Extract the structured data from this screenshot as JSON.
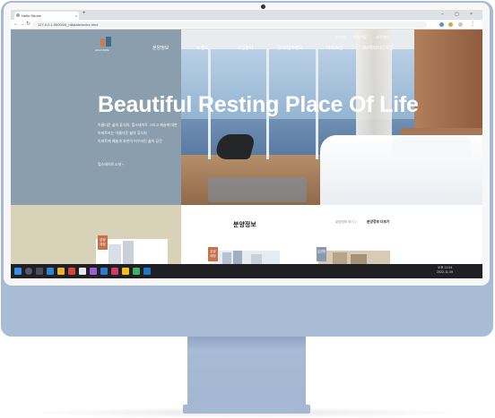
{
  "browser": {
    "tab_title": "Hello Strove",
    "url": "127.0.0.1:5500/09_hillstate/index.html"
  },
  "site": {
    "top_links": [
      "로그인",
      "회원가입",
      "고객센터"
    ],
    "nav": [
      "분양정보",
      "브랜드",
      "사업분야",
      "공사/입주정보",
      "아파트인",
      "BI/캐릭터디자인"
    ],
    "hero": {
      "title": "Beautiful Resting Place Of Life",
      "lines": [
        "아름다운 삶의 휴식처, 힐스테이트 그리고 캐슬에 대한",
        "아파트라는 아름다운 삶의 휴식처",
        "아파트에 예술과 자연이 어우러진 삶의 공간"
      ],
      "more": "힐스테이트소개 +"
    },
    "section": {
      "title": "분양정보",
      "crumb_prev": "분양정보 보기 >",
      "crumb_current": "분양정보 더보기"
    },
    "badges": [
      {
        "text": "분양\n예정",
        "color": "#c8704a"
      },
      {
        "text": "분양\n예정",
        "color": "#c8704a"
      },
      {
        "text": "분양중",
        "color": "#8a9aac"
      }
    ]
  },
  "taskbar": {
    "time": "오후 11:04",
    "date": "2022-11-09"
  },
  "colors": {
    "monitor": "#a7b9d4",
    "hero_panel": "#8a9eae",
    "beige": "#d8d3b8",
    "accent": "#c8704a"
  }
}
